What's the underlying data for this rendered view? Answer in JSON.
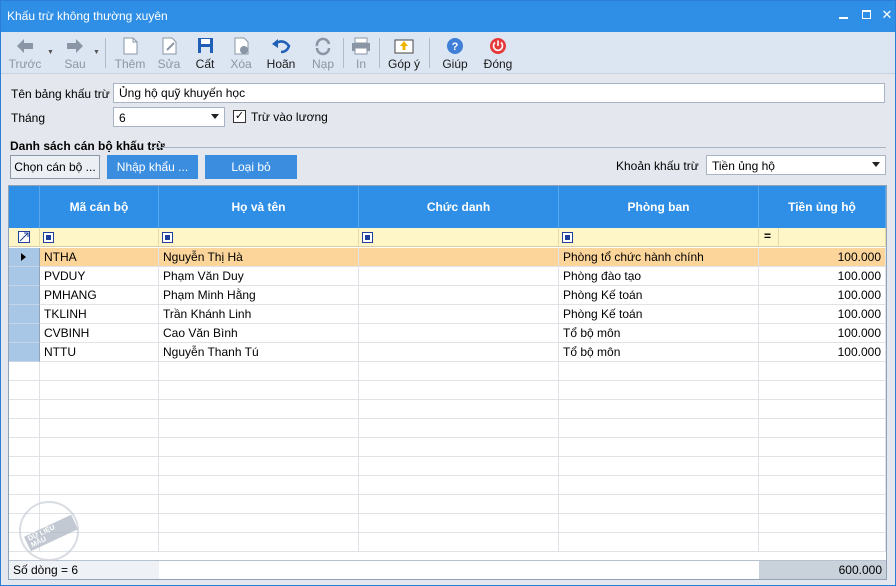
{
  "window": {
    "title": "Khấu trừ không thường xuyên"
  },
  "toolbar": {
    "buttons": [
      {
        "label": "Trước",
        "icon": "arrow-left-icon"
      },
      {
        "label": "Sau",
        "icon": "arrow-right-icon"
      },
      {
        "label": "Thêm",
        "icon": "add-document-icon"
      },
      {
        "label": "Sửa",
        "icon": "edit-document-icon"
      },
      {
        "label": "Cất",
        "icon": "save-icon"
      },
      {
        "label": "Xóa",
        "icon": "delete-document-icon"
      },
      {
        "label": "Hoãn",
        "icon": "undo-icon"
      },
      {
        "label": "Nạp",
        "icon": "refresh-icon"
      },
      {
        "label": "In",
        "icon": "printer-icon"
      },
      {
        "label": "Góp ý",
        "icon": "feedback-icon"
      },
      {
        "label": "Giúp",
        "icon": "help-icon"
      },
      {
        "label": "Đóng",
        "icon": "power-icon"
      }
    ]
  },
  "form": {
    "name_label": "Tên bảng khấu trừ",
    "name_value": "Ủng hộ quỹ khuyến học",
    "month_label": "Tháng",
    "month_value": "6",
    "deduct_checkbox_label": "Trừ vào lương",
    "deduct_checked": true
  },
  "section": {
    "title": "Danh sách cán bộ khấu trừ",
    "choose_button": "Chọn cán bộ ...",
    "import_button": "Nhập khẩu ...",
    "remove_button": "Loại bỏ",
    "deduction_label": "Khoản khấu trừ",
    "deduction_value": "Tiền ủng hộ"
  },
  "grid": {
    "columns": [
      "Mã cán bộ",
      "Họ và tên",
      "Chức danh",
      "Phòng ban",
      "Tiền ủng hộ"
    ],
    "rows": [
      {
        "code": "NTHA",
        "name": "Nguyễn Thị Hà",
        "title": "",
        "dept": "Phòng tổ chức hành chính",
        "amount": "100.000"
      },
      {
        "code": "PVDUY",
        "name": "Phạm Văn Duy",
        "title": "",
        "dept": "Phòng đào tạo",
        "amount": "100.000"
      },
      {
        "code": "PMHANG",
        "name": "Phạm Minh Hằng",
        "title": "",
        "dept": "Phòng Kế toán",
        "amount": "100.000"
      },
      {
        "code": "TKLINH",
        "name": "Trần Khánh Linh",
        "title": "",
        "dept": "Phòng Kế toán",
        "amount": "100.000"
      },
      {
        "code": "CVBINH",
        "name": "Cao Văn Bình",
        "title": "",
        "dept": "Tổ bộ môn",
        "amount": "100.000"
      },
      {
        "code": "NTTU",
        "name": "Nguyễn Thanh Tú",
        "title": "",
        "dept": "Tổ bộ môn",
        "amount": "100.000"
      }
    ],
    "row_count_text": "Số dòng = 6",
    "total_amount": "600.000",
    "amount_filter_op": "="
  },
  "watermark": {
    "text": "DỮ LIỆU MẪU"
  },
  "colors": {
    "titlebar": "#2f8fe6",
    "header": "#2f8fe6",
    "selected_row": "#fcd59a",
    "filter_row": "#fff6c8"
  }
}
